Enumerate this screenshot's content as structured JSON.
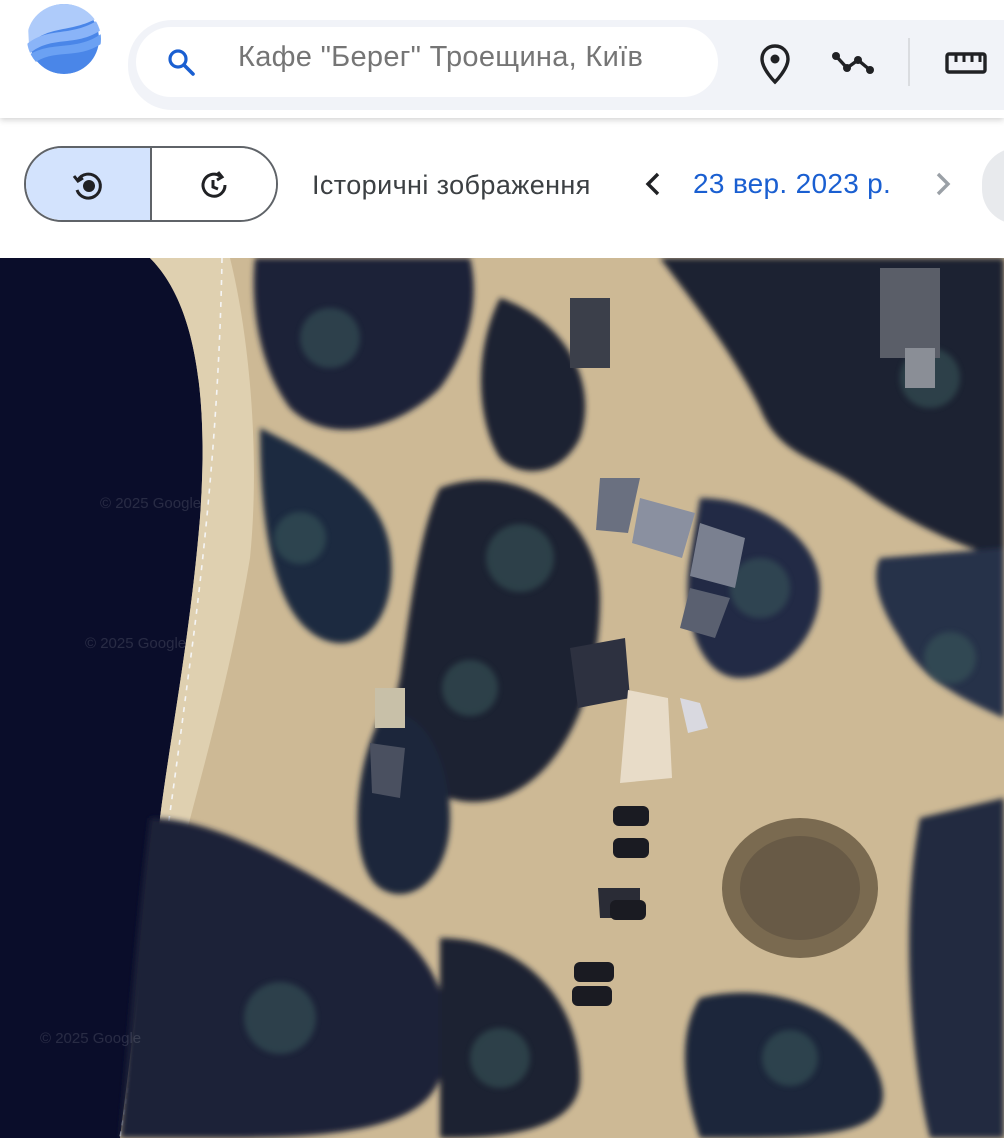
{
  "search": {
    "value": "Кафе \"Берег\" Троещина, Київ"
  },
  "toolbar": {
    "tools": [
      {
        "name": "place-marker-icon"
      },
      {
        "name": "path-tool-icon"
      },
      {
        "name": "ruler-icon"
      }
    ]
  },
  "history": {
    "label": "Історичні зображення",
    "date": "23 вер. 2023 р."
  },
  "map": {
    "watermarks": [
      "© 2025 Google",
      "© 2025 Google",
      "© 2025 Google"
    ]
  },
  "colors": {
    "accent": "#1a5fd1",
    "segment_active": "#d3e3fd",
    "water": "#0a0d2a",
    "sand": "#d8c6a4",
    "trees": "#1a2238"
  }
}
